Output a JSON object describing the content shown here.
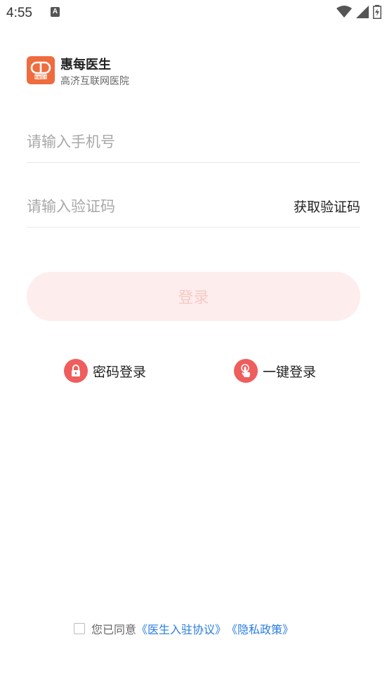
{
  "status_bar": {
    "time": "4:55",
    "notification_glyph": "A"
  },
  "brand": {
    "logo_text": "惠每医生",
    "name": "惠每医生",
    "subtitle": "高济互联网医院",
    "logo_color": "#ef6c3e"
  },
  "form": {
    "phone_placeholder": "请输入手机号",
    "code_placeholder": "请输入验证码",
    "get_code_label": "获取验证码",
    "login_label": "登录"
  },
  "alt_login": {
    "password_label": "密码登录",
    "onekey_label": "一键登录",
    "icon_color": "#ef5d5d"
  },
  "agreement": {
    "prefix": "您已同意",
    "doctor_agreement": "《医生入驻协议》",
    "privacy_policy": "《隐私政策》",
    "link_color": "#2a7de1"
  }
}
